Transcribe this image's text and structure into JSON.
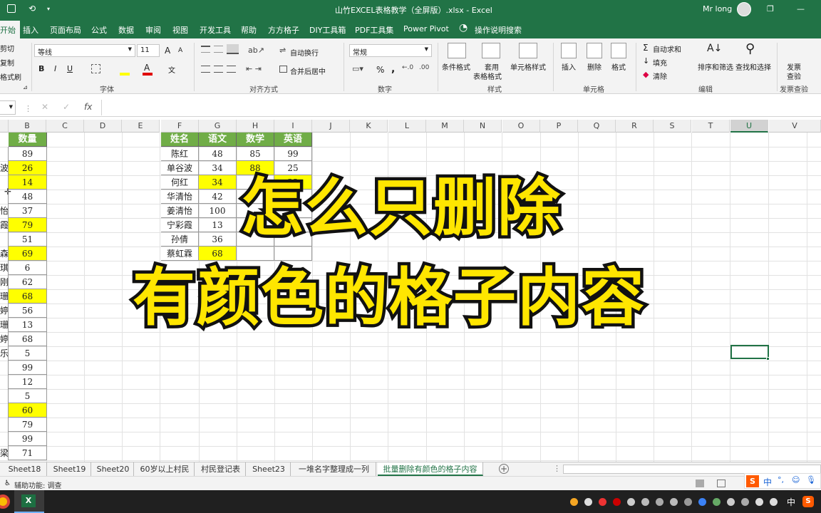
{
  "titlebar": {
    "title": "山竹EXCEL表格教学（全屏版）.xlsx  -  Excel",
    "user": "Mr long",
    "min": "—",
    "restore": "❐",
    "close": "✕"
  },
  "tabs": [
    "开始",
    "插入",
    "页面布局",
    "公式",
    "数据",
    "审阅",
    "视图",
    "开发工具",
    "帮助",
    "方方格子",
    "DIY工具箱",
    "PDF工具集",
    "Power Pivot"
  ],
  "tell_me": "操作说明搜索",
  "ribbon": {
    "clipboard": {
      "cut": "剪切",
      "copy": "复制",
      "painter": "格式刷"
    },
    "font": {
      "name": "等线",
      "size": "11",
      "grow": "A",
      "shrink": "A",
      "bold": "B",
      "italic": "I",
      "underline": "U",
      "wen": "文",
      "label": "字体"
    },
    "alignment": {
      "wrap": "自动换行",
      "merge": "合并后居中",
      "label": "对齐方式"
    },
    "number": {
      "format": "常规",
      "label": "数字",
      "percent": "%",
      "comma": ","
    },
    "styles": {
      "cond": "条件格式",
      "table1": "套用",
      "table2": "表格格式",
      "cell": "单元格样式",
      "label": "样式"
    },
    "cells": {
      "insert": "插入",
      "delete": "删除",
      "format": "格式",
      "label": "单元格"
    },
    "editing": {
      "autosum": "自动求和",
      "fill": "填充",
      "clear": "清除",
      "sort": "排序和筛选",
      "find": "查找和选择",
      "label": "编辑"
    },
    "check": {
      "l1": "发票",
      "l2": "查验",
      "label": "发票查验"
    }
  },
  "formula_bar": {
    "cancel": "✕",
    "enter": "✓",
    "fx": "fx"
  },
  "columns": [
    "B",
    "C",
    "D",
    "E",
    "F",
    "G",
    "H",
    "I",
    "J",
    "K",
    "L",
    "M",
    "N",
    "O",
    "P",
    "Q",
    "R",
    "S",
    "T",
    "U",
    "V"
  ],
  "selected_column": "U",
  "colB": {
    "header": "数量",
    "values": [
      "89",
      "26",
      "14",
      "48",
      "37",
      "79",
      "51",
      "69",
      "6",
      "62",
      "68",
      "56",
      "13",
      "68",
      "5",
      "99",
      "12",
      "5",
      "60",
      "79",
      "99",
      "71"
    ],
    "highlighted": [
      false,
      true,
      true,
      false,
      false,
      true,
      false,
      true,
      false,
      false,
      true,
      false,
      false,
      false,
      false,
      false,
      false,
      false,
      true,
      false,
      false,
      false
    ]
  },
  "colA_fragments": [
    "",
    "波",
    "",
    "",
    "怡",
    "霞",
    "",
    "森",
    "琪",
    "刚",
    "珊",
    "婷",
    "珊",
    "婷",
    "乐",
    "",
    "",
    "",
    "",
    "",
    "",
    "梁"
  ],
  "table": {
    "headers": [
      "姓名",
      "语文",
      "数学",
      "英语"
    ],
    "rows": [
      {
        "name": "陈红",
        "yuwen": "48",
        "shuxue": "85",
        "yingyu": "99"
      },
      {
        "name": "单谷波",
        "yuwen": "34",
        "shuxue": "88",
        "yingyu": "25"
      },
      {
        "name": "何红",
        "yuwen": "34",
        "shuxue": "",
        "yingyu": "22"
      },
      {
        "name": "华清怡",
        "yuwen": "42",
        "shuxue": "",
        "yingyu": ""
      },
      {
        "name": "姜清怡",
        "yuwen": "100",
        "shuxue": "",
        "yingyu": ""
      },
      {
        "name": "宁彩霞",
        "yuwen": "13",
        "shuxue": "",
        "yingyu": ""
      },
      {
        "name": "孙倩",
        "yuwen": "36",
        "shuxue": "",
        "yingyu": ""
      },
      {
        "name": "蔡虹霖",
        "yuwen": "68",
        "shuxue": "",
        "yingyu": ""
      }
    ],
    "highlights": [
      [
        false,
        false,
        false
      ],
      [
        false,
        true,
        false
      ],
      [
        true,
        false,
        true
      ],
      [
        false,
        false,
        false
      ],
      [
        false,
        false,
        false
      ],
      [
        false,
        false,
        false
      ],
      [
        false,
        false,
        false
      ],
      [
        true,
        false,
        false
      ]
    ]
  },
  "overlay": {
    "line1": "怎么只删除",
    "line2": "有颜色的格子内容"
  },
  "sheets": [
    "Sheet18",
    "Sheet19",
    "Sheet20",
    "60岁以上村民",
    "村民登记表",
    "Sheet23",
    "一堆名字整理成一列",
    "批量删除有颜色的格子内容"
  ],
  "active_sheet": "批量删除有颜色的格子内容",
  "status": {
    "accessibility": "辅助功能: 调查"
  },
  "taskbar": {
    "ime": "中",
    "ime2": "中"
  },
  "colors": {
    "excel_green": "#217346",
    "header_green": "#70ad47",
    "highlight": "#ffff00",
    "overlay_text": "#ffe600"
  }
}
